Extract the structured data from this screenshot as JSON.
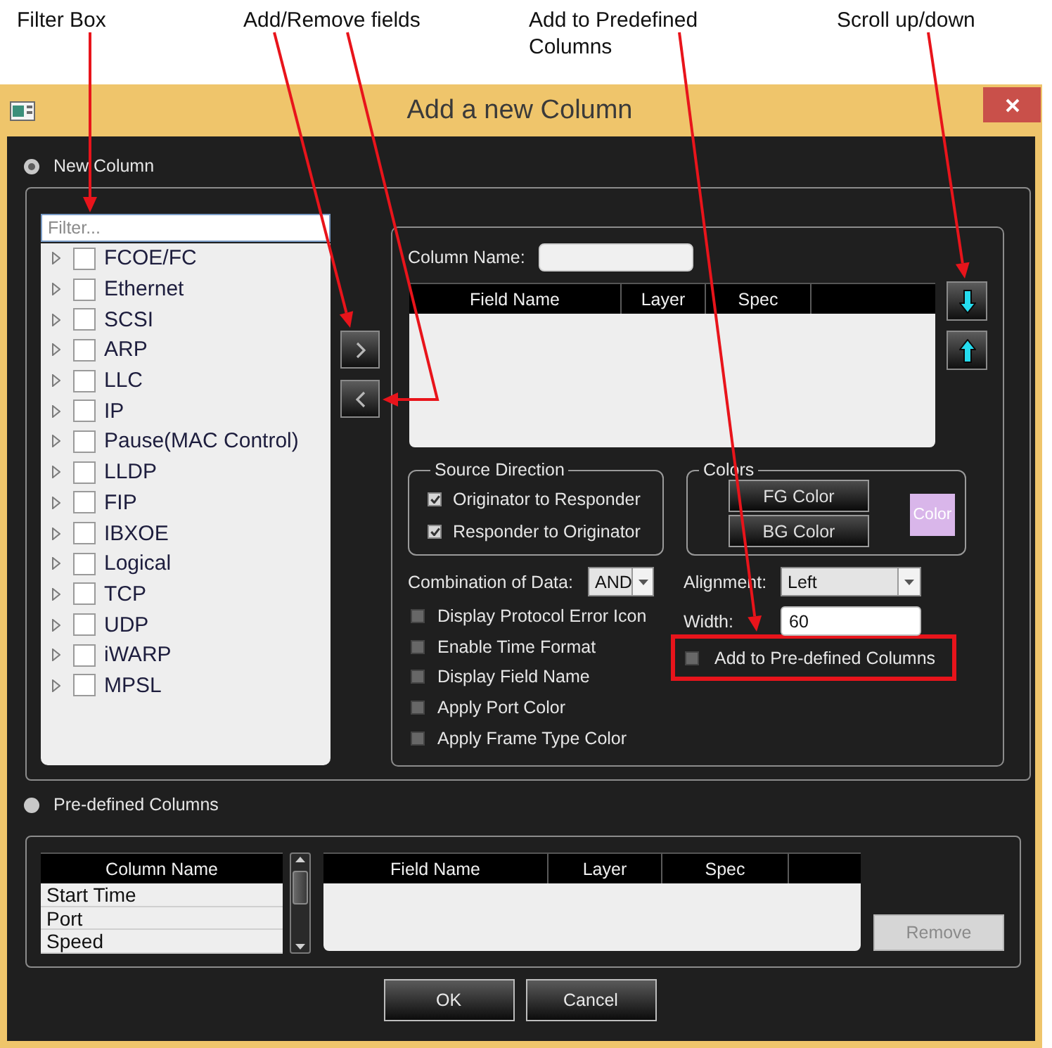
{
  "annotations": [
    {
      "text": "Filter Box"
    },
    {
      "text": "Add/Remove fields"
    },
    {
      "text": "Add to Predefined Columns"
    },
    {
      "text": "Scroll up/down"
    }
  ],
  "window": {
    "title": "Add a new Column"
  },
  "modes": [
    {
      "label": "New Column",
      "selected": true
    },
    {
      "label": "Pre-defined Columns",
      "selected": false
    }
  ],
  "filter": {
    "placeholder": "Filter..."
  },
  "tree": [
    {
      "label": "FCOE/FC",
      "checked": false,
      "expanded": false
    },
    {
      "label": "Ethernet",
      "checked": false,
      "expanded": false
    },
    {
      "label": "SCSI",
      "checked": false,
      "expanded": false
    },
    {
      "label": "ARP",
      "checked": false,
      "expanded": false
    },
    {
      "label": "LLC",
      "checked": false,
      "expanded": false
    },
    {
      "label": "IP",
      "checked": false,
      "expanded": false
    },
    {
      "label": "Pause(MAC Control)",
      "checked": false,
      "expanded": false
    },
    {
      "label": "LLDP",
      "checked": false,
      "expanded": false
    },
    {
      "label": "FIP",
      "checked": false,
      "expanded": false
    },
    {
      "label": "IBXOE",
      "checked": false,
      "expanded": false
    },
    {
      "label": "Logical",
      "checked": false,
      "expanded": false
    },
    {
      "label": "TCP",
      "checked": false,
      "expanded": false
    },
    {
      "label": "UDP",
      "checked": false,
      "expanded": false
    },
    {
      "label": "iWARP",
      "checked": false,
      "expanded": false
    },
    {
      "label": "MPSL",
      "checked": false,
      "expanded": false
    }
  ],
  "column_name": {
    "label": "Column Name:"
  },
  "fields_table": {
    "columns": [
      "Field Name",
      "Layer",
      "Spec"
    ]
  },
  "source_direction": {
    "title": "Source Direction",
    "options": [
      {
        "label": "Originator to Responder",
        "checked": true
      },
      {
        "label": "Responder to Originator",
        "checked": true
      }
    ]
  },
  "colors": {
    "title": "Colors",
    "buttons": [
      "FG Color",
      "BG Color"
    ],
    "swatch": {
      "label": "Color",
      "color": "#d9b6ea"
    }
  },
  "combination": {
    "label": "Combination of Data:",
    "value": "AND"
  },
  "options": [
    {
      "label": "Display Protocol Error Icon",
      "checked": false
    },
    {
      "label": "Enable Time Format",
      "checked": false
    },
    {
      "label": "Display Field Name",
      "checked": false
    },
    {
      "label": "Apply Port Color",
      "checked": false
    },
    {
      "label": "Apply Frame Type Color",
      "checked": false
    }
  ],
  "alignment": {
    "label": "Alignment:",
    "value": "Left"
  },
  "width": {
    "label": "Width:",
    "value": "60"
  },
  "add_predefined": {
    "label": "Add to Pre-defined Columns",
    "checked": false,
    "highlighted": true
  },
  "predefined": {
    "list": {
      "header": "Column Name",
      "rows": [
        {
          "label": "Start Time",
          "selected": false
        },
        {
          "label": "Port",
          "selected": false
        },
        {
          "label": "Speed",
          "selected": false
        }
      ]
    },
    "fields_table": {
      "columns": [
        "Field Name",
        "Layer",
        "Spec"
      ]
    },
    "remove_button": {
      "label": "Remove",
      "disabled": true
    }
  },
  "buttons": [
    "OK",
    "Cancel"
  ]
}
